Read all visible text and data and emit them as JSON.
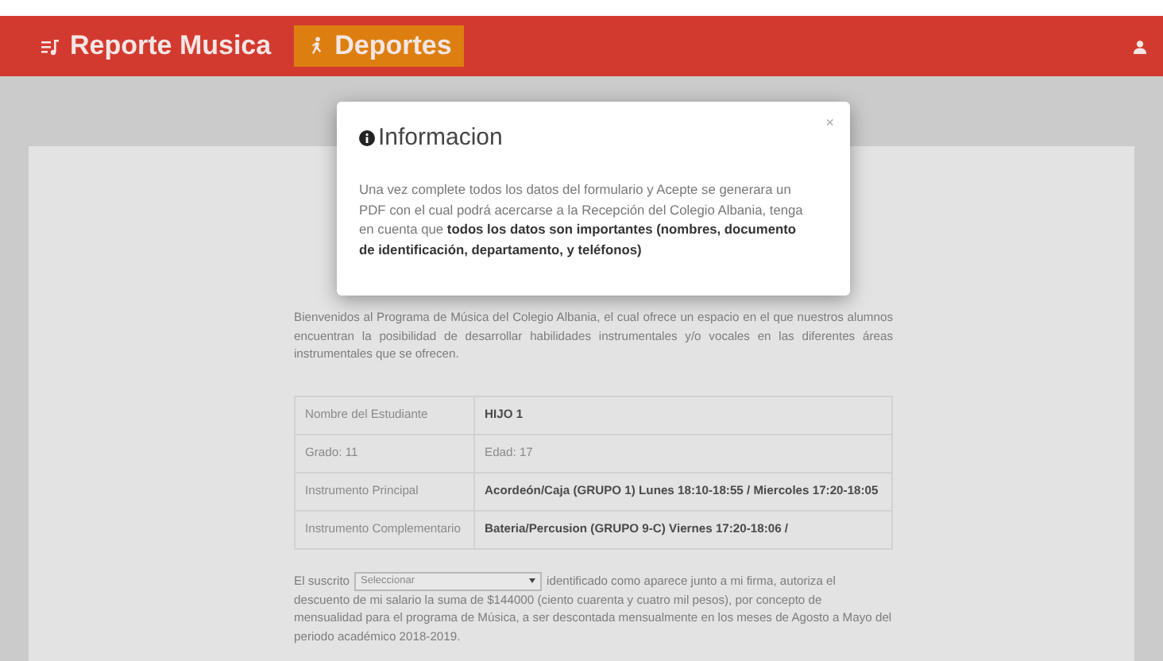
{
  "header": {
    "tabs": [
      {
        "label": "Reporte Musica",
        "selected": false
      },
      {
        "label": "Deportes",
        "selected": true
      }
    ]
  },
  "intro": "Bienvenidos al Programa de Música del Colegio Albania, el cual ofrece un espacio en el que nuestros alumnos encuentran la posibilidad de desarrollar habilidades instrumentales y/o vocales en las diferentes áreas instrumentales que se ofrecen.",
  "table": {
    "rows": [
      [
        {
          "text": "Nombre del Estudiante",
          "bold": false
        },
        {
          "text": "HIJO 1",
          "bold": true
        }
      ],
      [
        {
          "text": "Grado: 11",
          "bold": false
        },
        {
          "text": "Edad: 17",
          "bold": false
        }
      ],
      [
        {
          "text": "Instrumento Principal",
          "bold": false
        },
        {
          "text": "Acordeón/Caja (GRUPO 1) Lunes 18:10-18:55 / Miercoles 17:20-18:05",
          "bold": true
        }
      ],
      [
        {
          "text": "Instrumento Complementario",
          "bold": false
        },
        {
          "text": "Bateria/Percusion (GRUPO 9-C) Viernes 17:20-18:06 /",
          "bold": true
        }
      ]
    ]
  },
  "authorization": {
    "before": "El suscrito",
    "select": {
      "value": "Seleccionar"
    },
    "after": [
      "identificado como aparece junto a mi firma, autoriza el",
      "descuento de mi salario la suma de $144000 (ciento cuarenta y cuatro mil pesos), por concepto de mensualidad para el programa de Música, a ser descontada mensualmente en los meses de Agosto a Mayo del periodo académico 2018-2019."
    ]
  },
  "modal": {
    "title": "Informacion",
    "close": "×",
    "body": "Una vez complete todos los datos del formulario y Acepte se generara un PDF con el cual podrá acercarse a la Recepción del Colegio Albania, tenga en cuenta que **todos los datos son importantes (nombres, documento de identificación, departamento, y teléfonos)**"
  }
}
